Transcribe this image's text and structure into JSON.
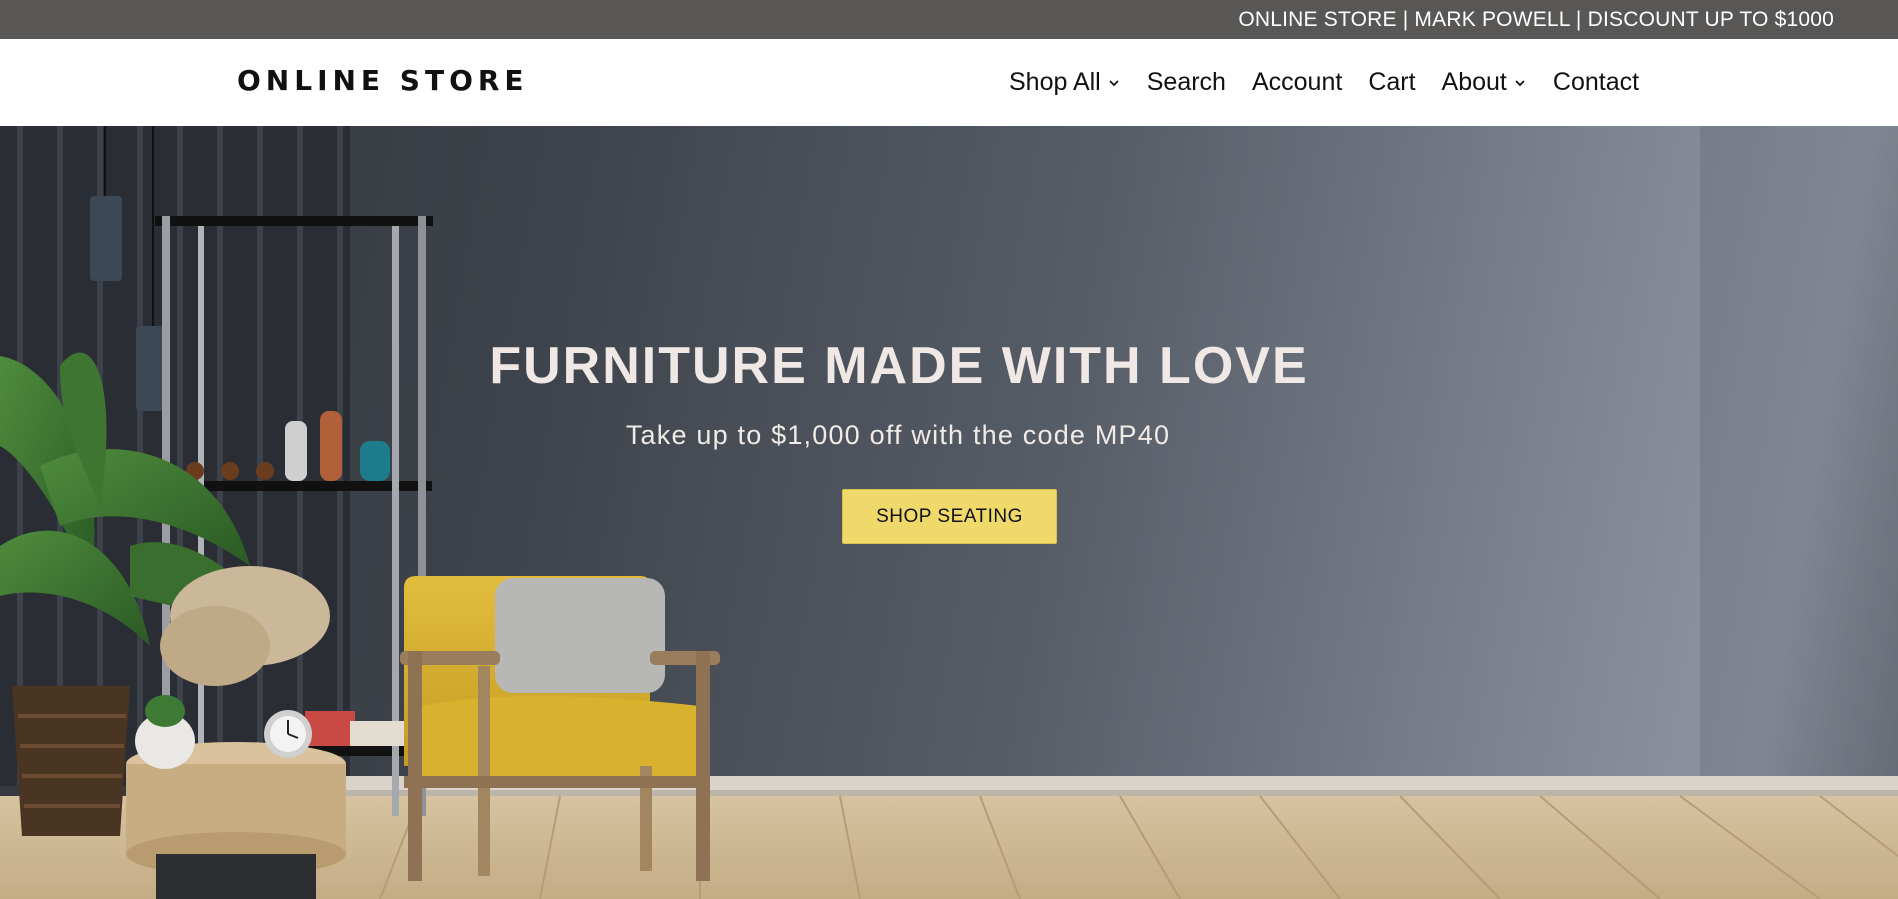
{
  "announcement": {
    "text": "ONLINE STORE | MARK POWELL | DISCOUNT UP TO $1000"
  },
  "header": {
    "logo": "ONLINE STORE",
    "nav": [
      {
        "label": "Shop All",
        "dropdown": true
      },
      {
        "label": "Search",
        "dropdown": false
      },
      {
        "label": "Account",
        "dropdown": false
      },
      {
        "label": "Cart",
        "dropdown": false
      },
      {
        "label": "About",
        "dropdown": true
      },
      {
        "label": "Contact",
        "dropdown": false
      }
    ]
  },
  "hero": {
    "title": "FURNITURE MADE WITH LOVE",
    "subtitle": "Take up to $1,000 off with the code MP40",
    "cta_label": "SHOP SEATING",
    "background_image": "living-room-yellow-armchair-photo"
  },
  "colors": {
    "announcement_bg": "#585756",
    "cta_bg": "#efd96a",
    "hero_wall": "#4f555e"
  }
}
